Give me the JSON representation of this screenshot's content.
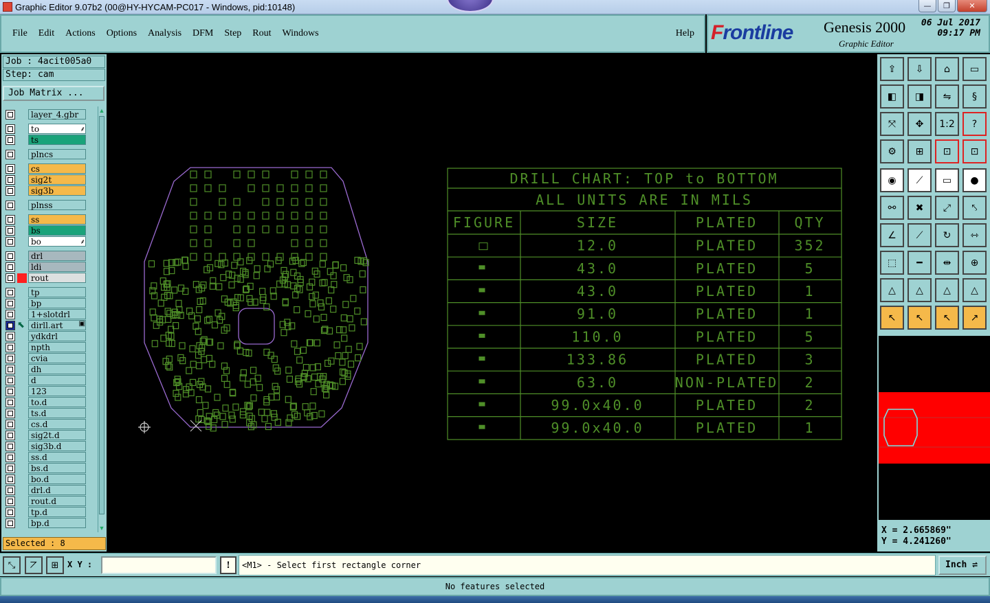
{
  "window": {
    "title": "Graphic Editor 9.07b2 (00@HY-HYCAM-PC017 - Windows, pid:10148)",
    "minimize": "—",
    "maximize": "❐",
    "close": "✕"
  },
  "menu": {
    "items": [
      {
        "label": "File"
      },
      {
        "label": "Edit"
      },
      {
        "label": "Actions"
      },
      {
        "label": "Options"
      },
      {
        "label": "Analysis"
      },
      {
        "label": "DFM"
      },
      {
        "label": "Step"
      },
      {
        "label": "Rout"
      },
      {
        "label": "Windows"
      }
    ],
    "help": "Help"
  },
  "brand": {
    "logo_prefix": "F",
    "logo_rest": "rontline",
    "product": "Genesis 2000",
    "subtitle": "Graphic Editor",
    "date": "06 Jul 2017",
    "time": "09:17 PM"
  },
  "job": {
    "job_label": "Job : 4acit005a0",
    "step_label": "Step: cam",
    "matrix_button": "Job Matrix ..."
  },
  "layers": [
    {
      "name": "layer_4.gbr",
      "color": "#9ed2d2"
    },
    {
      "name": "to",
      "color": "#ffffff",
      "suffix": "⸙"
    },
    {
      "name": "ts",
      "color": "#1aa37a"
    },
    {
      "name": "plncs",
      "color": "#9ed2d2"
    },
    {
      "name": "cs",
      "color": "#f5b94a"
    },
    {
      "name": "sig2t",
      "color": "#f5b94a"
    },
    {
      "name": "sig3b",
      "color": "#f5b94a"
    },
    {
      "name": "plnss",
      "color": "#9ed2d2"
    },
    {
      "name": "ss",
      "color": "#f5b94a"
    },
    {
      "name": "bs",
      "color": "#1aa37a"
    },
    {
      "name": "bo",
      "color": "#ffffff",
      "suffix": "⸙"
    },
    {
      "name": "drl",
      "color": "#a7b8be"
    },
    {
      "name": "ldi",
      "color": "#a7b8be"
    },
    {
      "name": "rout",
      "color": "#dce0e0",
      "mark": "#ff2020"
    },
    {
      "name": "tp",
      "color": "#9ed2d2"
    },
    {
      "name": "bp",
      "color": "#9ed2d2"
    },
    {
      "name": "1+slotdrl",
      "color": "#9ed2d2"
    },
    {
      "name": "dirll.art",
      "color": "#9ed2d2",
      "active": true,
      "suffix": "▣"
    },
    {
      "name": "ydkdrl",
      "color": "#9ed2d2"
    },
    {
      "name": "npth",
      "color": "#9ed2d2"
    },
    {
      "name": "cvia",
      "color": "#9ed2d2"
    },
    {
      "name": "dh",
      "color": "#9ed2d2"
    },
    {
      "name": "d",
      "color": "#9ed2d2"
    },
    {
      "name": "123",
      "color": "#9ed2d2"
    },
    {
      "name": "to.d",
      "color": "#9ed2d2"
    },
    {
      "name": "ts.d",
      "color": "#9ed2d2"
    },
    {
      "name": "cs.d",
      "color": "#9ed2d2"
    },
    {
      "name": "sig2t.d",
      "color": "#9ed2d2"
    },
    {
      "name": "sig3b.d",
      "color": "#9ed2d2"
    },
    {
      "name": "ss.d",
      "color": "#9ed2d2"
    },
    {
      "name": "bs.d",
      "color": "#9ed2d2"
    },
    {
      "name": "bo.d",
      "color": "#9ed2d2"
    },
    {
      "name": "drl.d",
      "color": "#9ed2d2"
    },
    {
      "name": "rout.d",
      "color": "#9ed2d2"
    },
    {
      "name": "tp.d",
      "color": "#9ed2d2"
    },
    {
      "name": "bp.d",
      "color": "#9ed2d2"
    }
  ],
  "selected_label": "Selected : 8",
  "drill_chart": {
    "title": "DRILL CHART: TOP to BOTTOM",
    "units": "ALL UNITS ARE IN MILS",
    "headers": [
      "FIGURE",
      "SIZE",
      "PLATED",
      "QTY"
    ],
    "rows": [
      {
        "size": "12.0",
        "plated": "PLATED",
        "qty": "352"
      },
      {
        "size": "43.0",
        "plated": "PLATED",
        "qty": "5"
      },
      {
        "size": "43.0",
        "plated": "PLATED",
        "qty": "1"
      },
      {
        "size": "91.0",
        "plated": "PLATED",
        "qty": "1"
      },
      {
        "size": "110.0",
        "plated": "PLATED",
        "qty": "5"
      },
      {
        "size": "133.86",
        "plated": "PLATED",
        "qty": "3"
      },
      {
        "size": "63.0",
        "plated": "NON-PLATED",
        "qty": "2"
      },
      {
        "size": "99.0x40.0",
        "plated": "PLATED",
        "qty": "2"
      },
      {
        "size": "99.0x40.0",
        "plated": "PLATED",
        "qty": "1"
      }
    ]
  },
  "colors": {
    "panel": "#9ed2d2",
    "drawing": "#4f8f28",
    "outline": "#9a6ad0",
    "preview_fill": "#ff0000"
  },
  "coords": {
    "x": "X = 2.665869\"",
    "y": "Y = 4.241260\""
  },
  "bottom": {
    "xy_label": "X Y :",
    "xy_value": "",
    "bang": "!",
    "prompt": "<M1> - Select first rectangle corner",
    "units": "Inch ⇌",
    "status": "No features selected"
  },
  "toolbar_right": {
    "one_to_two": "1:2",
    "help": "?"
  }
}
